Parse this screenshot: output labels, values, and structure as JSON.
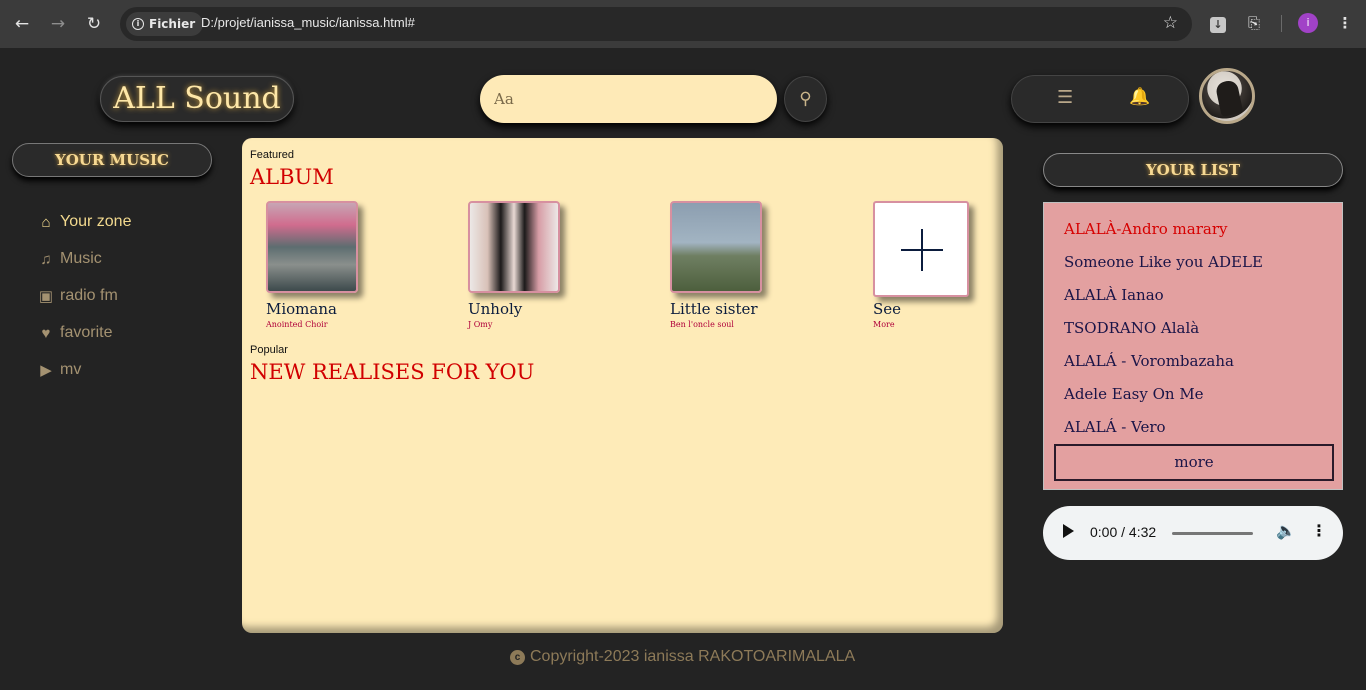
{
  "browser": {
    "site_chip": "Fichier",
    "url": "D:/projet/ianissa_music/ianissa.html#",
    "profile_initial": "i"
  },
  "header": {
    "logo": "ALL Sound",
    "search_placeholder": "Aa"
  },
  "sidebar": {
    "title": "YOUR MUSIC",
    "items": [
      {
        "label": "Your zone",
        "icon": "home-icon",
        "active": true
      },
      {
        "label": "Music",
        "icon": "music-icon"
      },
      {
        "label": "radio fm",
        "icon": "radio-icon"
      },
      {
        "label": "favorite",
        "icon": "heart-icon"
      },
      {
        "label": "mv",
        "icon": "youtube-icon"
      }
    ]
  },
  "main": {
    "featured_label": "Featured",
    "album_heading": "ALBUM",
    "albums": [
      {
        "title": "Miomana",
        "artist": "Anointed Choir"
      },
      {
        "title": "Unholy",
        "artist": "J Omy"
      },
      {
        "title": "Little sister",
        "artist": "Ben l'oncle soul"
      },
      {
        "title": "See",
        "artist": "More"
      }
    ],
    "popular_label": "Popular",
    "new_heading": "NEW REALISES FOR YOU"
  },
  "right_panel": {
    "title": "YOUR LIST",
    "items": [
      "ALALÀ-Andro marary",
      "Someone Like you ADELE",
      "ALALÀ Ianao",
      "TSODRANO Alalà",
      "ALALÁ - Vorombazaha",
      "Adele Easy On Me",
      "ALALÁ - Vero"
    ],
    "more_label": "more"
  },
  "audio": {
    "time": "0:00 / 4:32"
  },
  "footer": {
    "text": "Copyright-2023 ianissa RAKOTOARIMALALA"
  }
}
